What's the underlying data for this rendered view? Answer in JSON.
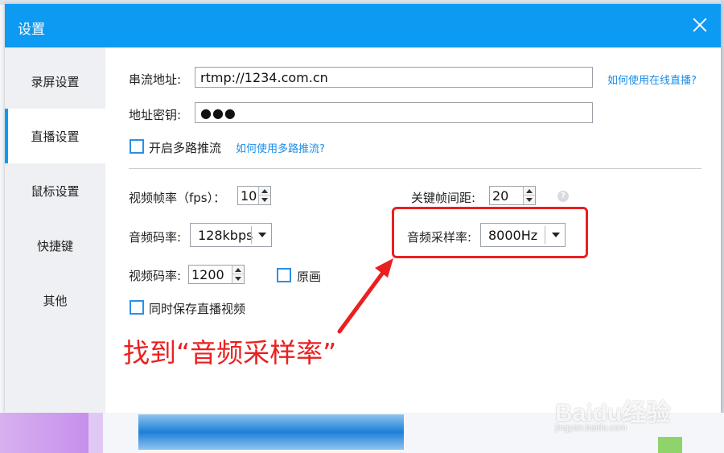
{
  "dialog": {
    "title": "设置",
    "close_icon": "close-icon"
  },
  "sidebar": {
    "items": [
      {
        "label": "录屏设置",
        "active": false
      },
      {
        "label": "直播设置",
        "active": true
      },
      {
        "label": "鼠标设置",
        "active": false
      },
      {
        "label": "快捷键",
        "active": false
      },
      {
        "label": "其他",
        "active": false
      }
    ]
  },
  "stream": {
    "url_label": "串流地址:",
    "url_value": "rtmp://1234.com.cn",
    "help_link": "如何使用在线直播?",
    "key_label": "地址密钥:",
    "key_value": "●●●",
    "multi_label": "开启多路推流",
    "multi_link": "如何使用多路推流?"
  },
  "video": {
    "fps_label": "视频帧率（fps）：",
    "fps_value": "10",
    "keyframe_label": "关键帧间距:",
    "keyframe_value": "20",
    "audio_bitrate_label": "音频码率:",
    "audio_bitrate_value": "128kbps",
    "sample_rate_label": "音频采样率:",
    "sample_rate_value": "8000Hz",
    "video_bitrate_label": "视频码率:",
    "video_bitrate_value": "1200",
    "original_label": "原画",
    "save_label": "同时保存直播视频",
    "help_glyph": "?"
  },
  "annotation": {
    "text": "找到“音频采样率”",
    "color": "#ea2020"
  },
  "watermark": {
    "brand": "Baidu经验",
    "url": "jingyan.baidu.com"
  },
  "colors": {
    "accent": "#0c9af3",
    "link": "#1a8de8"
  }
}
